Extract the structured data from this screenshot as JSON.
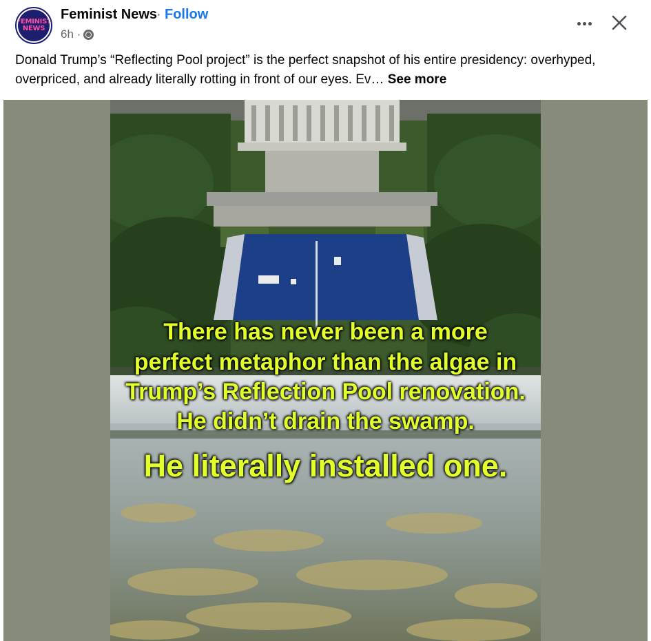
{
  "post": {
    "page_name": "Feminist News",
    "separator": "·",
    "follow_label": "Follow",
    "timestamp": "6h ·",
    "avatar_text": [
      "FEMINIST",
      "NEWS"
    ],
    "privacy_icon": "globe-icon",
    "more_icon": "more-options-icon",
    "close_icon": "close-icon",
    "text": "Donald Trump’s “Reflecting Pool project” is the perfect snapshot of his entire presidency: overhyped, overpriced, and already literally rotting in front of our eyes. Ev…",
    "see_more": "See more"
  },
  "image": {
    "caption_lines": [
      "There has never been a more",
      "perfect metaphor than the algae in",
      "Trump’s Reflection Pool renovation.",
      "He didn’t drain the swamp.",
      "He literally installed one."
    ]
  },
  "colors": {
    "follow": "#1877f2",
    "caption": "#e2ff2b",
    "media_background": "#878b7c",
    "secondary_text": "#65676b"
  }
}
